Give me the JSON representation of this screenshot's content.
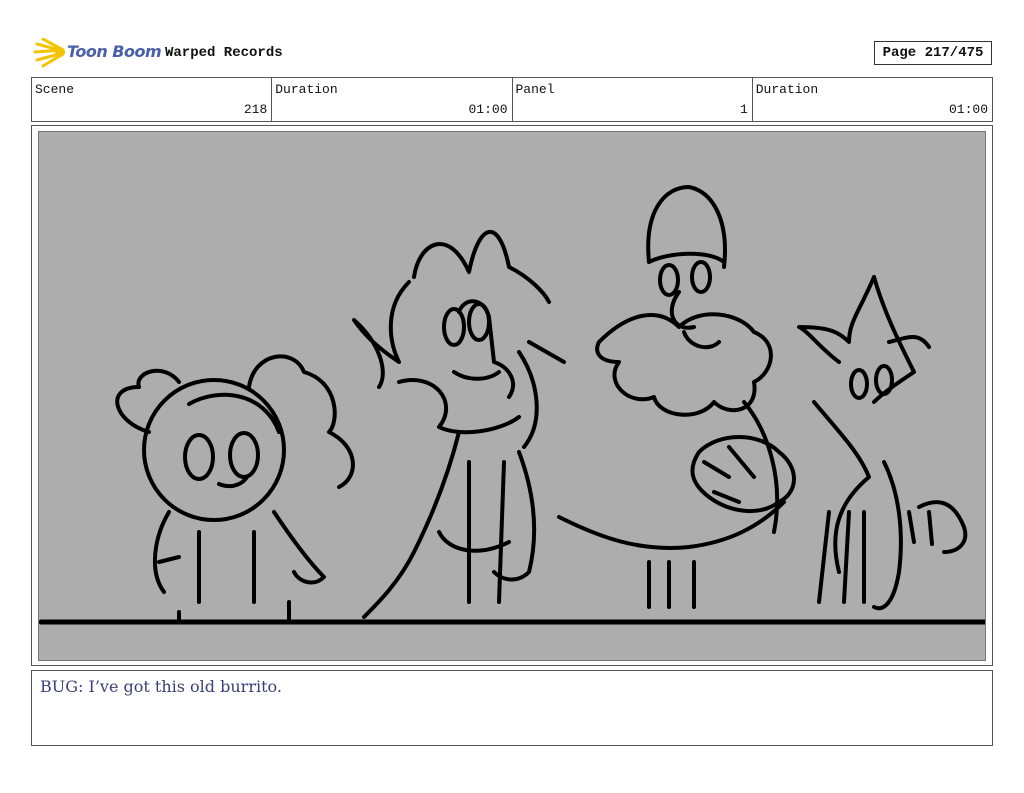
{
  "header": {
    "brand_name": "Toon Boom",
    "project_title": "Warped Records",
    "page_label": "Page 217/475"
  },
  "info": {
    "scene_label": "Scene",
    "scene_value": "218",
    "scene_duration_label": "Duration",
    "scene_duration_value": "01:00",
    "panel_label": "Panel",
    "panel_value": "1",
    "panel_duration_label": "Duration",
    "panel_duration_value": "01:00"
  },
  "dialogue": {
    "text": "BUG: I’ve got this old burrito."
  },
  "colors": {
    "panel_background": "#adadad",
    "logo_accent": "#f5c400",
    "brand_text": "#4a5fa8",
    "dialogue_text": "#3a3f7a"
  }
}
